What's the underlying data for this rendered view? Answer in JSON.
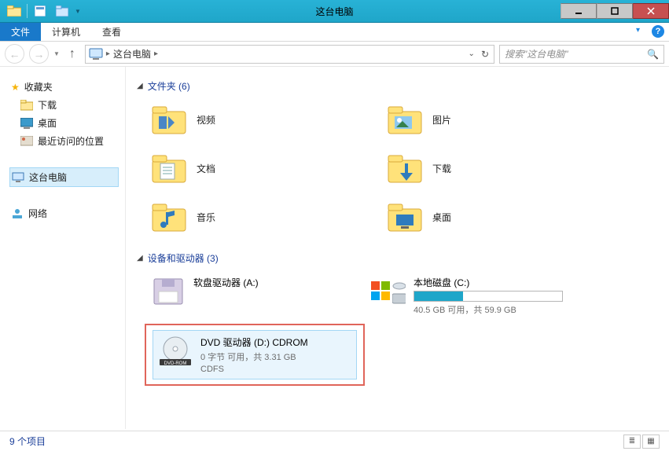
{
  "window": {
    "title": "这台电脑"
  },
  "ribbon": {
    "file": "文件",
    "computer": "计算机",
    "view": "查看"
  },
  "address": {
    "root": "这台电脑",
    "search_placeholder": "搜索\"这台电脑\""
  },
  "sidebar": {
    "favorites": "收藏夹",
    "downloads": "下载",
    "desktop": "桌面",
    "recent": "最近访问的位置",
    "this_pc": "这台电脑",
    "network": "网络"
  },
  "sections": {
    "folders_header": "文件夹 (6)",
    "devices_header": "设备和驱动器 (3)"
  },
  "folders": {
    "video": "视频",
    "pictures": "图片",
    "documents": "文档",
    "downloads": "下载",
    "music": "音乐",
    "desktop": "桌面"
  },
  "drives": {
    "floppy": {
      "name": "软盘驱动器 (A:)"
    },
    "c": {
      "name": "本地磁盘 (C:)",
      "info": "40.5 GB 可用，共 59.9 GB",
      "fill_pct": 33
    },
    "dvd": {
      "name": "DVD 驱动器 (D:) CDROM",
      "info": "0 字节 可用，共 3.31 GB",
      "fs": "CDFS"
    }
  },
  "status": {
    "items": "9 个项目"
  }
}
